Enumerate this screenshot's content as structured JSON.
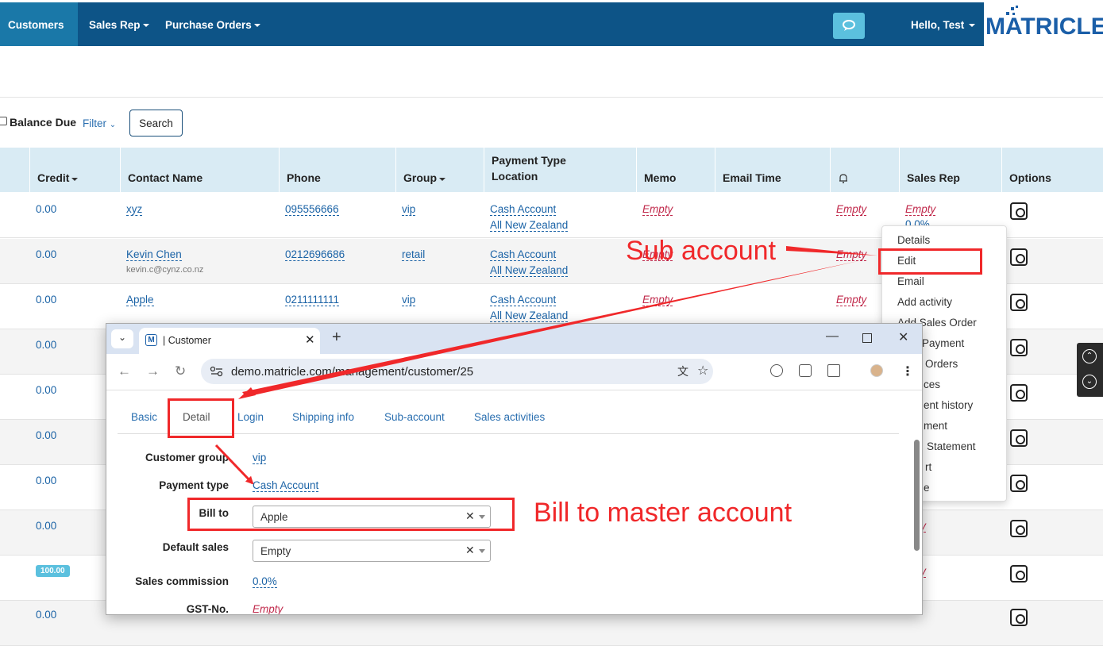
{
  "nav": {
    "items": [
      "Customers",
      "Sales Rep",
      "Purchase Orders"
    ],
    "user": "Hello, Test",
    "logo": "MATRICLE"
  },
  "filters": {
    "balance_due_label": "Balance Due",
    "filter_label": "Filter",
    "search_button": "Search"
  },
  "table": {
    "headers": {
      "credit": "Credit",
      "contact": "Contact Name",
      "phone": "Phone",
      "group": "Group",
      "payment_type": "Payment Type",
      "location": "Location",
      "memo": "Memo",
      "email_time": "Email Time",
      "sales_rep": "Sales Rep",
      "options": "Options"
    },
    "rows": [
      {
        "credit": "0.00",
        "contact": "xyz",
        "email": "",
        "phone": "095556666",
        "group": "vip",
        "payment": "Cash Account",
        "location": "All New Zealand",
        "memo": "Empty",
        "bell": "Empty",
        "rep": "Empty",
        "rep_pct": "0.0%"
      },
      {
        "credit": "0.00",
        "contact": "Kevin Chen",
        "email": "kevin.c@cynz.co.nz",
        "phone": "0212696686",
        "group": "retail",
        "payment": "Cash Account",
        "location": "All New Zealand",
        "memo": "Empty",
        "bell": "Empty",
        "rep": "",
        "rep_pct": ""
      },
      {
        "credit": "0.00",
        "contact": "Apple",
        "email": "",
        "phone": "0211111111",
        "group": "vip",
        "payment": "Cash Account",
        "location": "All New Zealand",
        "memo": "Empty",
        "bell": "Empty",
        "rep": "",
        "rep_pct": ""
      }
    ],
    "credit_only": [
      "0.00",
      "0.00",
      "0.00",
      "0.00",
      "0.00",
      "0.00"
    ],
    "badge": "100.00",
    "last_credit": "0.00",
    "right_fragments": [
      "pty",
      "%",
      "pty",
      "%"
    ]
  },
  "options_menu": {
    "items": [
      "Details",
      "Edit",
      "Email",
      "Add activity",
      "Add Sales Order",
      "Payment",
      "Orders",
      "ces",
      "ent history",
      "ment",
      "Statement",
      "rt",
      "e"
    ]
  },
  "browser": {
    "tab_title": "| Customer",
    "url": "demo.matricle.com/management/customer/25",
    "favicon": "M"
  },
  "customer_form": {
    "tabs": [
      "Basic",
      "Detail",
      "Login",
      "Shipping info",
      "Sub-account",
      "Sales activities"
    ],
    "fields": [
      {
        "label": "Customer group",
        "value": "vip"
      },
      {
        "label": "Payment type",
        "value": "Cash Account"
      },
      {
        "label": "Bill to",
        "value": "Apple"
      },
      {
        "label": "Default sales",
        "value": "Empty"
      },
      {
        "label": "Sales commission",
        "value": "0.0%"
      },
      {
        "label": "GST-No.",
        "value": "Empty"
      }
    ]
  },
  "annotations": {
    "sub_account": "Sub account",
    "bill_to_master": "Bill to master account",
    "color": "#f0282a"
  }
}
